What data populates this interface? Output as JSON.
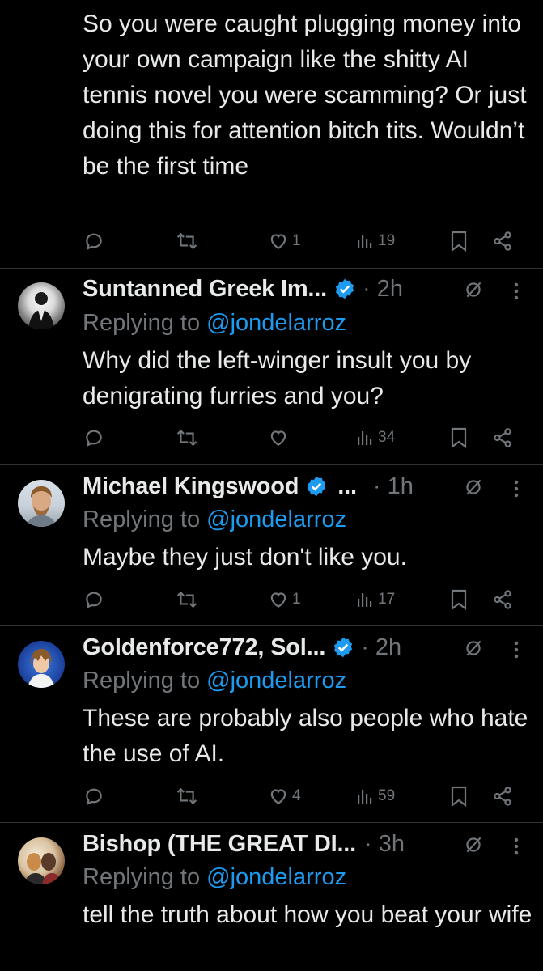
{
  "first_tweet": {
    "text": "So you were caught plugging money into your own campaign like the shitty AI tennis novel you were scamming?   Or just doing this for attention bitch tits.  Wouldn’t be the first time",
    "actions": {
      "replies": "",
      "reposts": "",
      "likes": "1",
      "views": "19"
    }
  },
  "replies": [
    {
      "name": "Suntanned Greek Im...",
      "verified": true,
      "time": "· 2h",
      "replying_prefix": "Replying to",
      "handle": "@jondelarroz",
      "text": "Why did the left-winger insult you by denigrating furries and you?",
      "actions": {
        "replies": "",
        "reposts": "",
        "likes": "",
        "views": "34"
      }
    },
    {
      "name": "Michael Kingswood",
      "verified": true,
      "name_suffix": "...",
      "time": "· 1h",
      "replying_prefix": "Replying to",
      "handle": "@jondelarroz",
      "text": "Maybe they just don't like you.",
      "actions": {
        "replies": "",
        "reposts": "",
        "likes": "1",
        "views": "17"
      }
    },
    {
      "name": "Goldenforce772, Sol...",
      "verified": true,
      "time": "· 2h",
      "replying_prefix": "Replying to",
      "handle": "@jondelarroz",
      "text": "These are probably also people who hate the use of AI.",
      "actions": {
        "replies": "",
        "reposts": "",
        "likes": "4",
        "views": "59"
      }
    },
    {
      "name": "Bishop (THE GREAT DI...",
      "verified": false,
      "time": "· 3h",
      "replying_prefix": "Replying to",
      "handle": "@jondelarroz",
      "text": "tell the truth about how you beat your wife"
    }
  ],
  "colors": {
    "background": "#000000",
    "text": "#e7e9ea",
    "muted": "#71767b",
    "link": "#1d9bf0",
    "divider": "#2f3336",
    "verified": "#1d9bf0"
  },
  "icons": [
    "reply-icon",
    "repost-icon",
    "like-icon",
    "views-icon",
    "bookmark-icon",
    "share-icon",
    "grok-icon",
    "more-icon",
    "verified-badge-icon"
  ]
}
